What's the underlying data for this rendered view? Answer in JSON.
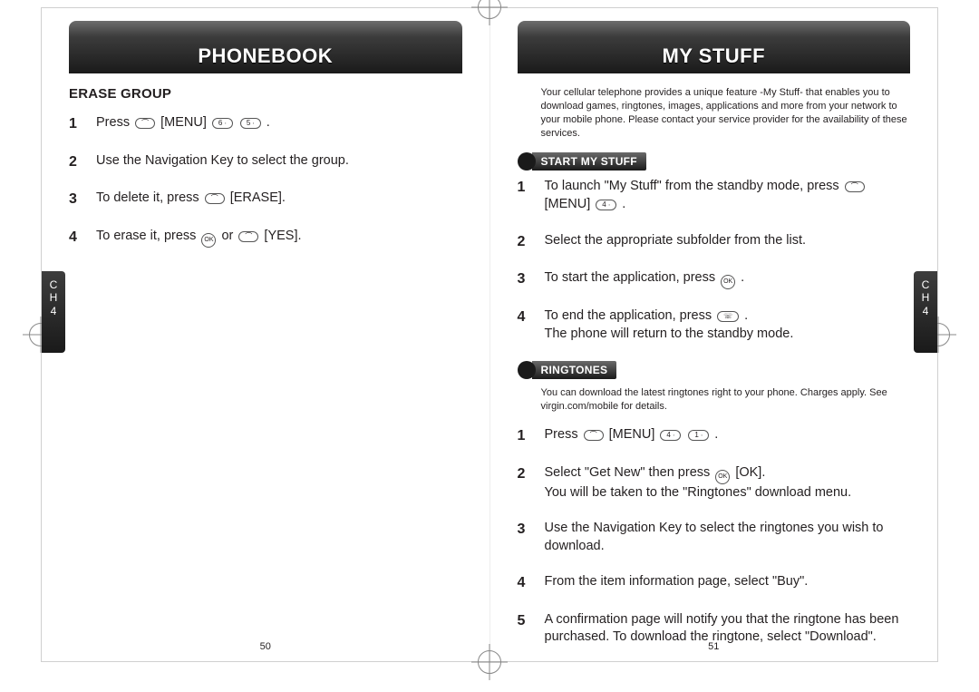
{
  "left": {
    "title": "PHONEBOOK",
    "subhead": "ERASE GROUP",
    "steps": [
      "Press [SOFT] [MENU] [6] [5] .",
      "Use the Navigation Key to select the group.",
      "To delete it, press [SOFT] [ERASE].",
      "To erase it, press [OK] or [SOFT] [YES]."
    ],
    "side_ch": "C\nH",
    "side_num": "4",
    "pagenum": "50"
  },
  "right": {
    "title": "MY STUFF",
    "intro": "Your cellular telephone provides a unique feature -My Stuff- that enables you to download games, ringtones, images, applications and more from your network to your mobile phone. Please contact your service provider for the availability of these services.",
    "section1": "START MY STUFF",
    "steps1": [
      "To launch \"My Stuff\" from the standby mode, press [SOFT] [MENU] [4] .",
      "Select the appropriate subfolder from the list.",
      "To start the application, press [OK] .",
      "To end the application, press [END] .\nThe phone will return to the standby mode."
    ],
    "section2": "RINGTONES",
    "intro2": "You can download the latest ringtones right to your phone. Charges apply. See virgin.com/mobile for details.",
    "steps2": [
      "Press [SOFT] [MENU] [4] [1] .",
      "Select \"Get New\" then press [OK] [OK].\nYou will be taken to the \"Ringtones\" download menu.",
      "Use the Navigation Key to select the ringtones you wish to download.",
      "From the item information page, select \"Buy\".",
      "A confirmation page will notify you that the ringtone has been purchased. To download the ringtone, select \"Download\"."
    ],
    "side_ch": "C\nH",
    "side_num": "4",
    "pagenum": "51"
  }
}
